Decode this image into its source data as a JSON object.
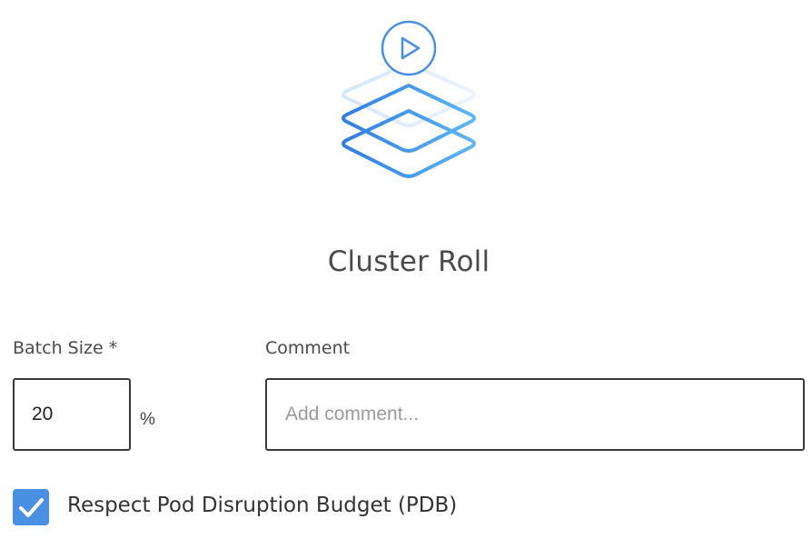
{
  "dialog": {
    "title": "Cluster Roll",
    "illustration_icon": "layers-play-icon",
    "accent_color": "#4a90e2"
  },
  "batch_size": {
    "label": "Batch Size *",
    "value": "20",
    "unit": "%"
  },
  "comment": {
    "label": "Comment",
    "value": "",
    "placeholder": "Add comment..."
  },
  "pdb": {
    "label": "Respect Pod Disruption Budget (PDB)",
    "checked": true,
    "icon": "check-icon"
  }
}
